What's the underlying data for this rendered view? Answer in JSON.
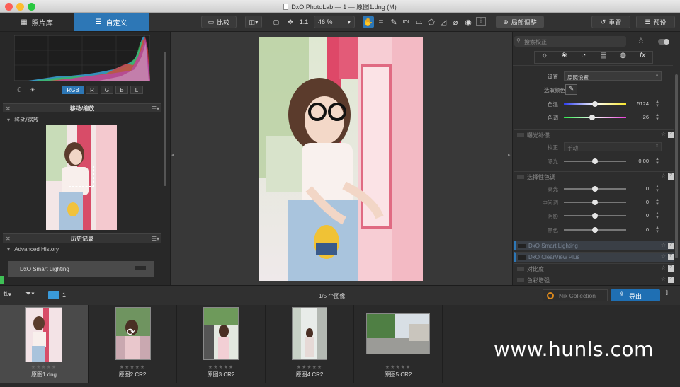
{
  "window": {
    "title": "DxO PhotoLab — 1 — 原图1.dng (M)"
  },
  "toolbar": {
    "tab_library": "照片库",
    "tab_customize": "自定义",
    "compare": "比较",
    "ratio": "1:1",
    "zoom": "46 %",
    "local_adjust": "局部调整",
    "reset": "重置",
    "preset": "预设"
  },
  "histogram": {
    "channels": [
      "RGB",
      "R",
      "G",
      "B",
      "L"
    ],
    "active_channel": "RGB"
  },
  "left_panel": {
    "move_zoom_title": "移动/缩放",
    "move_zoom_sub": "移动/缩放",
    "history_title": "历史记录",
    "history_group": "Advanced History",
    "history_items": [
      "DxO Smart Lighting"
    ]
  },
  "right_panel": {
    "search_placeholder": "搜索校正",
    "white_balance": {
      "setting_label": "设置",
      "setting_value": "原照设置",
      "picker_label": "选取颜色",
      "temp_label": "色温",
      "temp_value": 5124,
      "tint_label": "色调",
      "tint_value": -26
    },
    "exposure": {
      "title": "曝光补偿",
      "mode_label": "校正",
      "mode_value": "手动",
      "exposure_label": "曝光",
      "exposure_value": "0.00"
    },
    "selective_tone": {
      "title": "选择性色调",
      "rows": [
        {
          "label": "高光",
          "value": "0"
        },
        {
          "label": "中间调",
          "value": "0"
        },
        {
          "label": "阴影",
          "value": "0"
        },
        {
          "label": "黑色",
          "value": "0"
        }
      ]
    },
    "other_sections": [
      "DxO Smart Lighting",
      "DxO ClearView Plus",
      "对比度",
      "色彩增强"
    ]
  },
  "filmstrip": {
    "folder_count": "1",
    "image_count": "1/5 个图像",
    "nik_collection": "Nik Collection",
    "export": "导出",
    "images": [
      "原图1.dng",
      "原图2.CR2",
      "原图3.CR2",
      "原图4.CR2",
      "原图5.CR2"
    ],
    "stars": "★★★★★"
  },
  "watermark": "www.hunls.com",
  "colors": {
    "accent": "#2d77b6",
    "export_button": "#1f6fb3",
    "panel_bg": "#2d2d2d"
  }
}
